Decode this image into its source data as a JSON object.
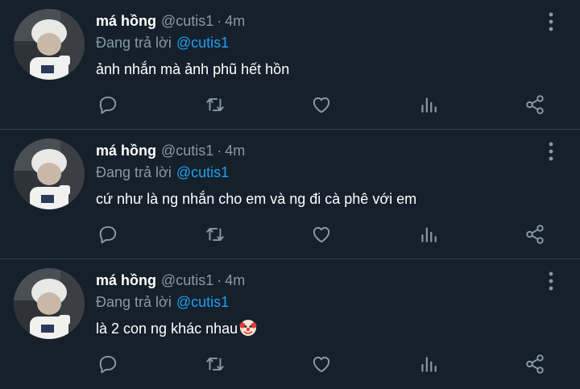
{
  "tweets": [
    {
      "name": "má hồng",
      "handle": "@cutis1",
      "time": "4m",
      "reply_prefix": "Đang trả lời",
      "reply_to": "@cutis1",
      "text": "ảnh nhắn mà ảnh phũ hết hồn",
      "emoji": ""
    },
    {
      "name": "má hồng",
      "handle": "@cutis1",
      "time": "4m",
      "reply_prefix": "Đang trả lời",
      "reply_to": "@cutis1",
      "text": "cứ như là ng nhắn cho em và ng đi cà phê với em",
      "emoji": ""
    },
    {
      "name": "má hồng",
      "handle": "@cutis1",
      "time": "4m",
      "reply_prefix": "Đang trả lời",
      "reply_to": "@cutis1",
      "text": "là 2 con ng khác nhau",
      "emoji": "clown-face-emoji"
    }
  ],
  "separator": "·",
  "icons": {
    "more": "more-vertical-icon",
    "reply": "reply-icon",
    "retweet": "retweet-icon",
    "like": "heart-icon",
    "analytics": "analytics-icon",
    "share": "share-icon"
  },
  "colors": {
    "background": "#15202b",
    "secondary_text": "#8899a6",
    "accent": "#1da1f2",
    "divider": "#38444d"
  }
}
